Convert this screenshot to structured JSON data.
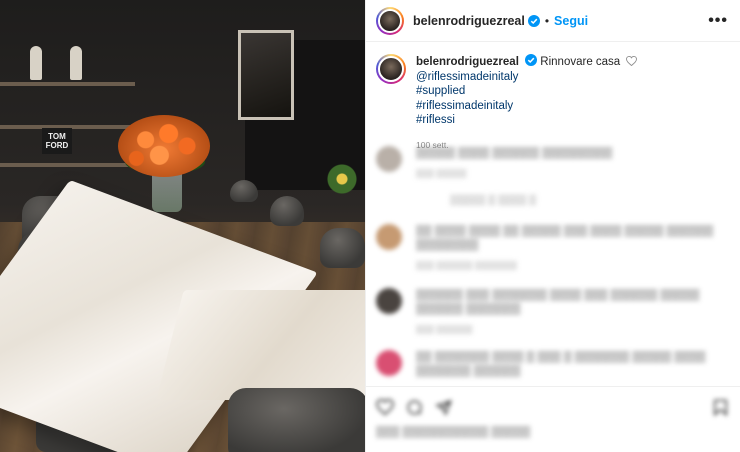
{
  "post": {
    "author": {
      "username": "belenrodriguezreal",
      "verified": true,
      "avatar_icon": "profile-avatar"
    },
    "follow_label": "Segui",
    "separator": "•",
    "more_label": "•••",
    "caption": {
      "text": "Rinnovare casa",
      "mention": "@riflessimadeinitaly",
      "hashtags": [
        "#supplied",
        "#riflessimadeinitaly",
        "#riflessi"
      ],
      "time_ago": "100 sett."
    },
    "photo": {
      "book_label": "TOM FORD"
    },
    "comments": [
      {
        "text": "▒▒▒▒▒ ▒▒▒▒ ▒▒▒▒▒▒ ▒▒▒▒▒▒▒▒▒",
        "meta": "▒▒▒ ▒▒▒▒▒",
        "avatar_color": "#b9b0a8"
      },
      {
        "text": "▒▒ ▒▒▒▒ ▒▒▒▒ ▒▒ ▒▒▒▒▒ ▒▒▒ ▒▒▒▒ ▒▒▒▒▒ ▒▒▒▒▒▒ ▒▒▒▒▒▒▒▒",
        "meta": "▒▒▒ ▒▒▒▒▒▒ ▒▒▒▒▒▒▒",
        "avatar_color": "#c69a72"
      },
      {
        "text": "▒▒▒▒▒▒ ▒▒▒ ▒▒▒▒▒▒▒ ▒▒▒▒ ▒▒▒ ▒▒▒▒▒▒ ▒▒▒▒▒ ▒▒▒▒▒▒ ▒▒▒▒▒▒▒",
        "meta": "▒▒▒ ▒▒▒▒▒▒",
        "avatar_color": "#4a4440"
      },
      {
        "text": "▒▒ ▒▒▒▒▒▒▒ ▒▒▒▒ ▒ ▒▒▒ ▒ ▒▒▒▒▒▒▒ ▒▒▒▒▒ ▒▒▒▒ ▒▒▒▒▒▒▒ ▒▒▒▒▒▒",
        "meta": "",
        "avatar_color": "#d94f72"
      }
    ],
    "view_replies": "▒▒▒▒▒ ▒ ▒▒▒▒ ▒",
    "likes_text": "▒▒▒ ▒▒▒▒▒▒▒▒▒▒▒ ▒▒▒▒▒",
    "colors": {
      "accent_blue": "#0095f6",
      "link_blue": "#00376b",
      "muted": "#8e8e8e"
    }
  }
}
